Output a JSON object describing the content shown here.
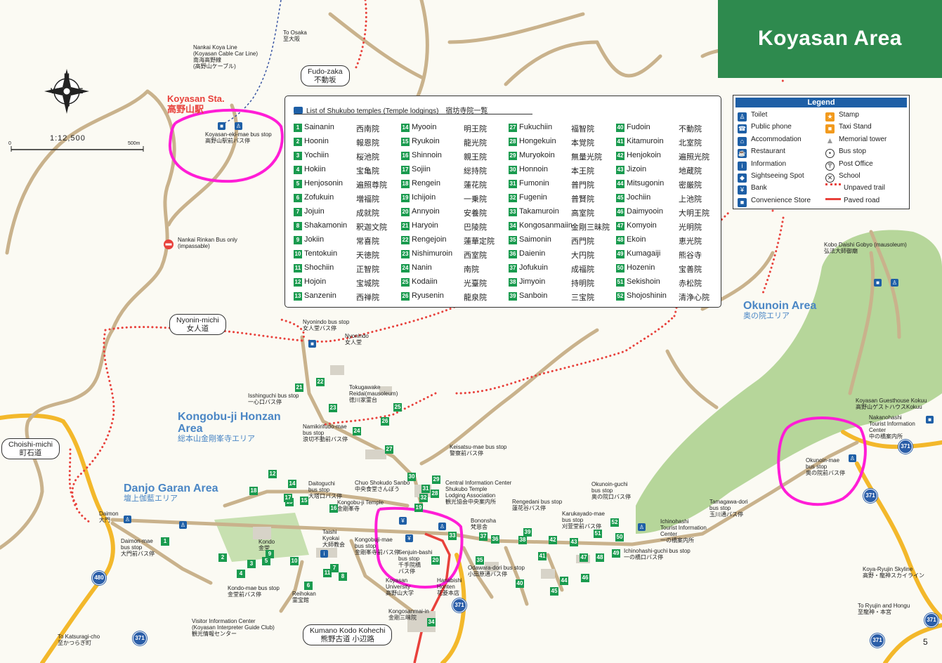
{
  "title": "Koyasan Area",
  "scale": {
    "ratio": "1:12,500",
    "zero": "0",
    "max": "500m"
  },
  "page_number": "5",
  "compass": {
    "n": "N",
    "s": "S",
    "e": "E",
    "w": "W"
  },
  "station": {
    "en": "Koyasan Sta.",
    "ja": "高野山駅"
  },
  "areas": {
    "okunoin": {
      "en": "Okunoin Area",
      "ja": "奥の院エリア"
    },
    "kongobuji": {
      "en": "Kongobu-ji Honzan Area",
      "en1": "Kongobu-ji Honzan",
      "en2": "Area",
      "ja": "総本山金剛峯寺エリア"
    },
    "danjo": {
      "en": "Danjo Garan Area",
      "ja": "壇上伽藍エリア"
    }
  },
  "trail_labels": {
    "fudozaka": {
      "en": "Fudo-zaka",
      "ja": "不動坂"
    },
    "nyonin": {
      "en": "Nyonin-michi",
      "ja": "女人道"
    },
    "choishi": {
      "en": "Choishi-michi",
      "ja": "町石道"
    },
    "kumano": {
      "en": "Kumano Kodo Kohechi",
      "ja": "熊野古道 小辺路"
    }
  },
  "map_labels": {
    "nankai_line": [
      "Nankai Koya Line",
      "(Koyasan Cable Car Line)",
      "南海高野線",
      "(高野山ケーブル)"
    ],
    "to_osaka": [
      "To Osaka",
      "至大阪"
    ],
    "ekimae_bus": [
      "Koyasan-eki-mae bus stop",
      "高野山駅前バス停"
    ],
    "rinkan_bus": [
      "Nankai Rinkan Bus only",
      "(impassable)"
    ],
    "nyonindo_bus": [
      "Nyonindo bus stop",
      "女人堂バス停"
    ],
    "nyonindo": [
      "Nyonindo",
      "女人堂"
    ],
    "isshinguchi": [
      "Isshinguchi bus stop",
      "一心口バス停"
    ],
    "tokugawake": [
      "Tokugawake",
      "Reidai(mausoleum)",
      "徳川家霊台"
    ],
    "namikiri": [
      "Namikirifudo-mae",
      "bus stop",
      "浪切不動前バス停"
    ],
    "keisatsu": [
      "Keisatsu-mae bus stop",
      "警察前バス停"
    ],
    "chuo_shokudo": [
      "Chuo Shokudo Sanbo",
      "中央食堂さんぼう"
    ],
    "central_info": [
      "Central Information Center",
      "Shukubo Temple",
      "Lodging Association",
      "観光協会中央案内所"
    ],
    "daitoguchi": [
      "Daitoguchi",
      "bus stop",
      "大塔口バス停"
    ],
    "kongobuji_temple": [
      "Kongobu-ji Temple",
      "金剛峯寺"
    ],
    "daimon": [
      "Daimon",
      "大門"
    ],
    "daimon_bus": [
      "Daimon-mae",
      "bus stop",
      "大門前バス停"
    ],
    "kondo": [
      "Kondo",
      "金堂"
    ],
    "taishi_kyokai": [
      "Taishi",
      "Kyokai",
      "大師教会"
    ],
    "kongobuji_mae": [
      "Kongobuji-mae",
      "bus stop",
      "金剛峯寺前バス停"
    ],
    "senjuin": [
      "Senjuin-bashi",
      "bus stop",
      "千手院橋",
      "バス停"
    ],
    "kondo_mae": [
      "Kondo-mae bus stop",
      "金堂前バス停"
    ],
    "reihokan": [
      "Reihokan",
      "霊宝館"
    ],
    "visitor_center": [
      "Visitor Information Center",
      "(Koyasan Interpreter Guide Club)",
      "観光情報センター"
    ],
    "university": [
      "Koyasan",
      "University",
      "高野山大学"
    ],
    "hanabishi": [
      "Hanabishi",
      "Honten",
      "花菱本店"
    ],
    "kongosanmai": [
      "Kongosanmai-in",
      "金剛三昧院"
    ],
    "bononsha": [
      "Bononsha",
      "梵恩舎"
    ],
    "rengedani": [
      "Rengedani bus stop",
      "蓮花谷バス停"
    ],
    "odawara": [
      "Odawara-dori bus stop",
      "小田原通バス停"
    ],
    "karukaya": [
      "Karukayado-mae",
      "bus stop",
      "刈萱堂前バス停"
    ],
    "okunoin_guchi": [
      "Okunoin-guchi",
      "bus stop",
      "奥の院口バス停"
    ],
    "ichinohashi_info": [
      "Ichinohashi",
      "Tourist Information",
      "Center",
      "一の橋案内所"
    ],
    "ichinohashi_bus": [
      "Ichinohashi-guchi bus stop",
      "一の橋口バス停"
    ],
    "tamagawa": [
      "Tamagawa-dori",
      "bus stop",
      "玉川通バス停"
    ],
    "kobo_gobyo": [
      "Kobo Daishi Gobyo (mausoleum)",
      "弘法大師御廟"
    ],
    "guesthouse": [
      "Koyasan Guesthouse Kokuu",
      "高野山ゲストハウスKokuu"
    ],
    "nakanohashi": [
      "Nakanohashi",
      "Tourist Information",
      "Center",
      "中の橋案内所"
    ],
    "okunoin_mae": [
      "Okunoin-mae",
      "bus stop",
      "奥の院前バス停"
    ],
    "ryujin": [
      "Koya-Ryujin Skyline",
      "高野・龍神スカイライン"
    ],
    "to_ryujin": [
      "To Ryujin and Hongu",
      "至龍神・本宮"
    ],
    "to_katsuragi": [
      "To Katsuragi-cho",
      "至かつらぎ町"
    ]
  },
  "routes": {
    "r480": "480",
    "r371": "371"
  },
  "shukubo": {
    "heading": "List of Shukubo temples (Temple lodgings)　宿坊寺院一覧",
    "columns": [
      [
        {
          "n": "1",
          "en": "Sainanin",
          "ja": "西南院"
        },
        {
          "n": "2",
          "en": "Hoonin",
          "ja": "報恩院"
        },
        {
          "n": "3",
          "en": "Yochiin",
          "ja": "桜池院"
        },
        {
          "n": "4",
          "en": "Hokiin",
          "ja": "宝亀院"
        },
        {
          "n": "5",
          "en": "Henjosonin",
          "ja": "遍照尊院"
        },
        {
          "n": "6",
          "en": "Zofukuin",
          "ja": "増福院"
        },
        {
          "n": "7",
          "en": "Jojuin",
          "ja": "成就院"
        },
        {
          "n": "8",
          "en": "Shakamonin",
          "ja": "釈迦文院"
        },
        {
          "n": "9",
          "en": "Jokiin",
          "ja": "常喜院"
        },
        {
          "n": "10",
          "en": "Tentokuin",
          "ja": "天徳院"
        },
        {
          "n": "11",
          "en": "Shochiin",
          "ja": "正智院"
        },
        {
          "n": "12",
          "en": "Hojoin",
          "ja": "宝城院"
        },
        {
          "n": "13",
          "en": "Sanzenin",
          "ja": "西禅院"
        }
      ],
      [
        {
          "n": "14",
          "en": "Myooin",
          "ja": "明王院"
        },
        {
          "n": "15",
          "en": "Ryukoin",
          "ja": "龍光院"
        },
        {
          "n": "16",
          "en": "Shinnoin",
          "ja": "親王院"
        },
        {
          "n": "17",
          "en": "Sojiin",
          "ja": "総持院"
        },
        {
          "n": "18",
          "en": "Rengein",
          "ja": "蓮花院"
        },
        {
          "n": "19",
          "en": "Ichijoin",
          "ja": "一乗院"
        },
        {
          "n": "20",
          "en": "Annyoin",
          "ja": "安養院"
        },
        {
          "n": "21",
          "en": "Haryoin",
          "ja": "巴陵院"
        },
        {
          "n": "22",
          "en": "Rengejoin",
          "ja": "蓮華定院"
        },
        {
          "n": "23",
          "en": "Nishimuroin",
          "ja": "西室院"
        },
        {
          "n": "24",
          "en": "Nanin",
          "ja": "南院"
        },
        {
          "n": "25",
          "en": "Kodaiin",
          "ja": "光臺院"
        },
        {
          "n": "26",
          "en": "Ryusenin",
          "ja": "龍泉院"
        }
      ],
      [
        {
          "n": "27",
          "en": "Fukuchiin",
          "ja": "福智院"
        },
        {
          "n": "28",
          "en": "Hongekuin",
          "ja": "本覚院"
        },
        {
          "n": "29",
          "en": "Muryokoin",
          "ja": "無量光院"
        },
        {
          "n": "30",
          "en": "Honnoin",
          "ja": "本王院"
        },
        {
          "n": "31",
          "en": "Fumonin",
          "ja": "普門院"
        },
        {
          "n": "32",
          "en": "Fugenin",
          "ja": "普賢院"
        },
        {
          "n": "33",
          "en": "Takamuroin",
          "ja": "高室院"
        },
        {
          "n": "34",
          "en": "Kongosanmaiin",
          "ja": "金剛三昧院"
        },
        {
          "n": "35",
          "en": "Saimonin",
          "ja": "西門院"
        },
        {
          "n": "36",
          "en": "Daienin",
          "ja": "大円院"
        },
        {
          "n": "37",
          "en": "Jofukuin",
          "ja": "成福院"
        },
        {
          "n": "38",
          "en": "Jimyoin",
          "ja": "持明院"
        },
        {
          "n": "39",
          "en": "Sanboin",
          "ja": "三宝院"
        }
      ],
      [
        {
          "n": "40",
          "en": "Fudoin",
          "ja": "不動院"
        },
        {
          "n": "41",
          "en": "Kitamuroin",
          "ja": "北室院"
        },
        {
          "n": "42",
          "en": "Henjokoin",
          "ja": "遍照光院"
        },
        {
          "n": "43",
          "en": "Jizoin",
          "ja": "地蔵院"
        },
        {
          "n": "44",
          "en": "Mitsugonin",
          "ja": "密厳院"
        },
        {
          "n": "45",
          "en": "Jochiin",
          "ja": "上池院"
        },
        {
          "n": "46",
          "en": "Daimyooin",
          "ja": "大明王院"
        },
        {
          "n": "47",
          "en": "Komyoin",
          "ja": "光明院"
        },
        {
          "n": "48",
          "en": "Ekoin",
          "ja": "恵光院"
        },
        {
          "n": "49",
          "en": "Kumagaiji",
          "ja": "熊谷寺"
        },
        {
          "n": "50",
          "en": "Hozenin",
          "ja": "宝善院"
        },
        {
          "n": "51",
          "en": "Sekishoin",
          "ja": "赤松院"
        },
        {
          "n": "52",
          "en": "Shojoshinin",
          "ja": "清浄心院"
        }
      ]
    ]
  },
  "legend": {
    "title": "Legend",
    "left": [
      "Toilet",
      "Public phone",
      "Accommodation",
      "Restaurant",
      "Information",
      "Sightseeing Spot",
      "Bank",
      "Convenience Store"
    ],
    "right": [
      "Stamp",
      "Taxi Stand",
      "Memorial tower",
      "Bus stop",
      "Post Office",
      "School",
      "Unpaved trail",
      "Paved road"
    ]
  },
  "map_numbers": [
    "1",
    "2",
    "3",
    "4",
    "5",
    "6",
    "7",
    "8",
    "9",
    "10",
    "11",
    "12",
    "13",
    "14",
    "15",
    "16",
    "17",
    "18",
    "19",
    "20",
    "21",
    "22",
    "23",
    "24",
    "25",
    "26",
    "27",
    "28",
    "29",
    "30",
    "31",
    "32",
    "33",
    "34",
    "35",
    "36",
    "37",
    "38",
    "39",
    "40",
    "41",
    "42",
    "43",
    "44",
    "45",
    "46",
    "47",
    "48",
    "49",
    "50",
    "51",
    "52"
  ],
  "colors": {
    "title_bg": "#2e8a4e",
    "trail": "#e8413b",
    "road": "#c9b28c",
    "highway": "#f3b82b",
    "forest": "#a9cf8a",
    "highlight": "#ff1dd6",
    "area_text": "#4a86c5",
    "temple_num": "#1a9b4f",
    "icon": "#1e5fa6"
  }
}
